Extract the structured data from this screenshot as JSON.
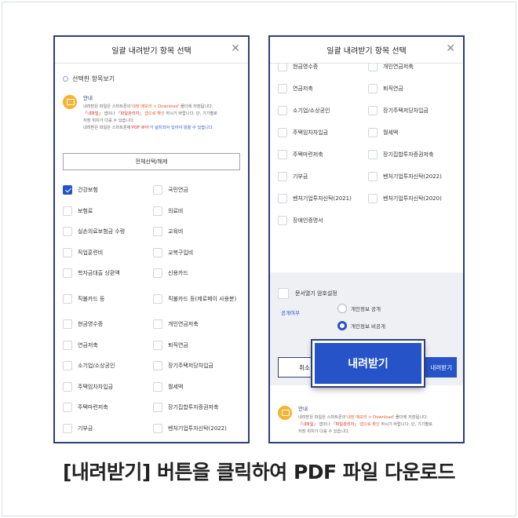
{
  "left_panel": {
    "title": "일괄 내려받기 항목 선택",
    "close_icon": "close-icon",
    "section_title": "선택한 항목보기",
    "notice": {
      "head": "안내",
      "line1_pre": "내려받은 파일은 스마트폰의",
      "line1_hl": "'내장 메모리 > Download'",
      "line1_post": "폴더에 저장됩니다.",
      "line2_hl1": "「내파일」",
      "line2_mid": "앱이나",
      "line2_hl2": "「파일관리자」",
      "line2_hl3": "앱으로 확인",
      "line2_post": "하시기 바랍니다. 단, 기기별로",
      "line3": "저장 위치가 다를 수 있습니다.",
      "line4_pre": "내려받은 파일은 스마트폰에",
      "line4_hl": "'PDF 뷰어'",
      "line4_post": "가 설치되어 있어야 읽을 수 있습니다."
    },
    "select_all_label": "전체선택/해제",
    "items": [
      [
        "건강보험",
        "국민연금"
      ],
      [
        "보험료",
        "의료비"
      ],
      [
        "실손의료보험금 수령",
        "교육비"
      ],
      [
        "직업훈련비",
        "교복구입비"
      ],
      [
        "학자금대출 상환액",
        "신용카드"
      ],
      [
        "직불카드 등",
        "직불카드 등(제로페이 사용분)"
      ],
      [
        "현금영수증",
        "개인연금저축"
      ],
      [
        "연금저축",
        "퇴직연금"
      ],
      [
        "소기업/소상공인",
        "장기주택저당차입금"
      ],
      [
        "주택임차차입금",
        "월세액"
      ],
      [
        "주택마련저축",
        "장기집합투자증권저축"
      ],
      [
        "기부금",
        "벤처기업투자신탁(2022)"
      ]
    ]
  },
  "right_panel": {
    "title": "일괄 내려받기 항목 선택",
    "close_icon": "close-icon",
    "items": [
      [
        "현금영수증",
        "개인연금저축"
      ],
      [
        "연금저축",
        "퇴직연금"
      ],
      [
        "소기업/소상공인",
        "장기주택저당차입금"
      ],
      [
        "주택임차차입금",
        "월세액"
      ],
      [
        "주택마련저축",
        "장기집합투자증권저축"
      ],
      [
        "기부금",
        "벤처기업투자신탁(2022)"
      ],
      [
        "벤처기업투자신탁(2021)",
        "벤처기업투자신탁(2020)"
      ],
      [
        "장애인증명서",
        ""
      ]
    ],
    "password_label": "문서열기 암호설정",
    "disclosure_label": "공개여부",
    "radio_public": "개인정보 공개",
    "radio_private": "개인정보 비공개",
    "cancel_label": "취소",
    "download_label": "내려받기",
    "download_zoom_label": "내려받기",
    "notice": {
      "head": "안내",
      "line1_pre": "내려받은 파일은 스마트폰의",
      "line1_hl": "'내장 메모리 > Download'",
      "line1_post": "폴더에 저장됩니다.",
      "line2_hl1": "「내파일」",
      "line2_mid": "앱이나",
      "line2_hl2": "「파일관리자」",
      "line2_hl3": "앱으로 확인",
      "line2_post": "하시기 바랍니다. 단, 기기별로",
      "line3": "저장 위치가 다를 수 있습니다."
    }
  },
  "caption": "[내려받기] 버튼을 클릭하여 PDF 파일 다운로드",
  "colors": {
    "accent": "#2653c8",
    "frame": "#2f3e73",
    "notice_icon": "#f7b231"
  }
}
